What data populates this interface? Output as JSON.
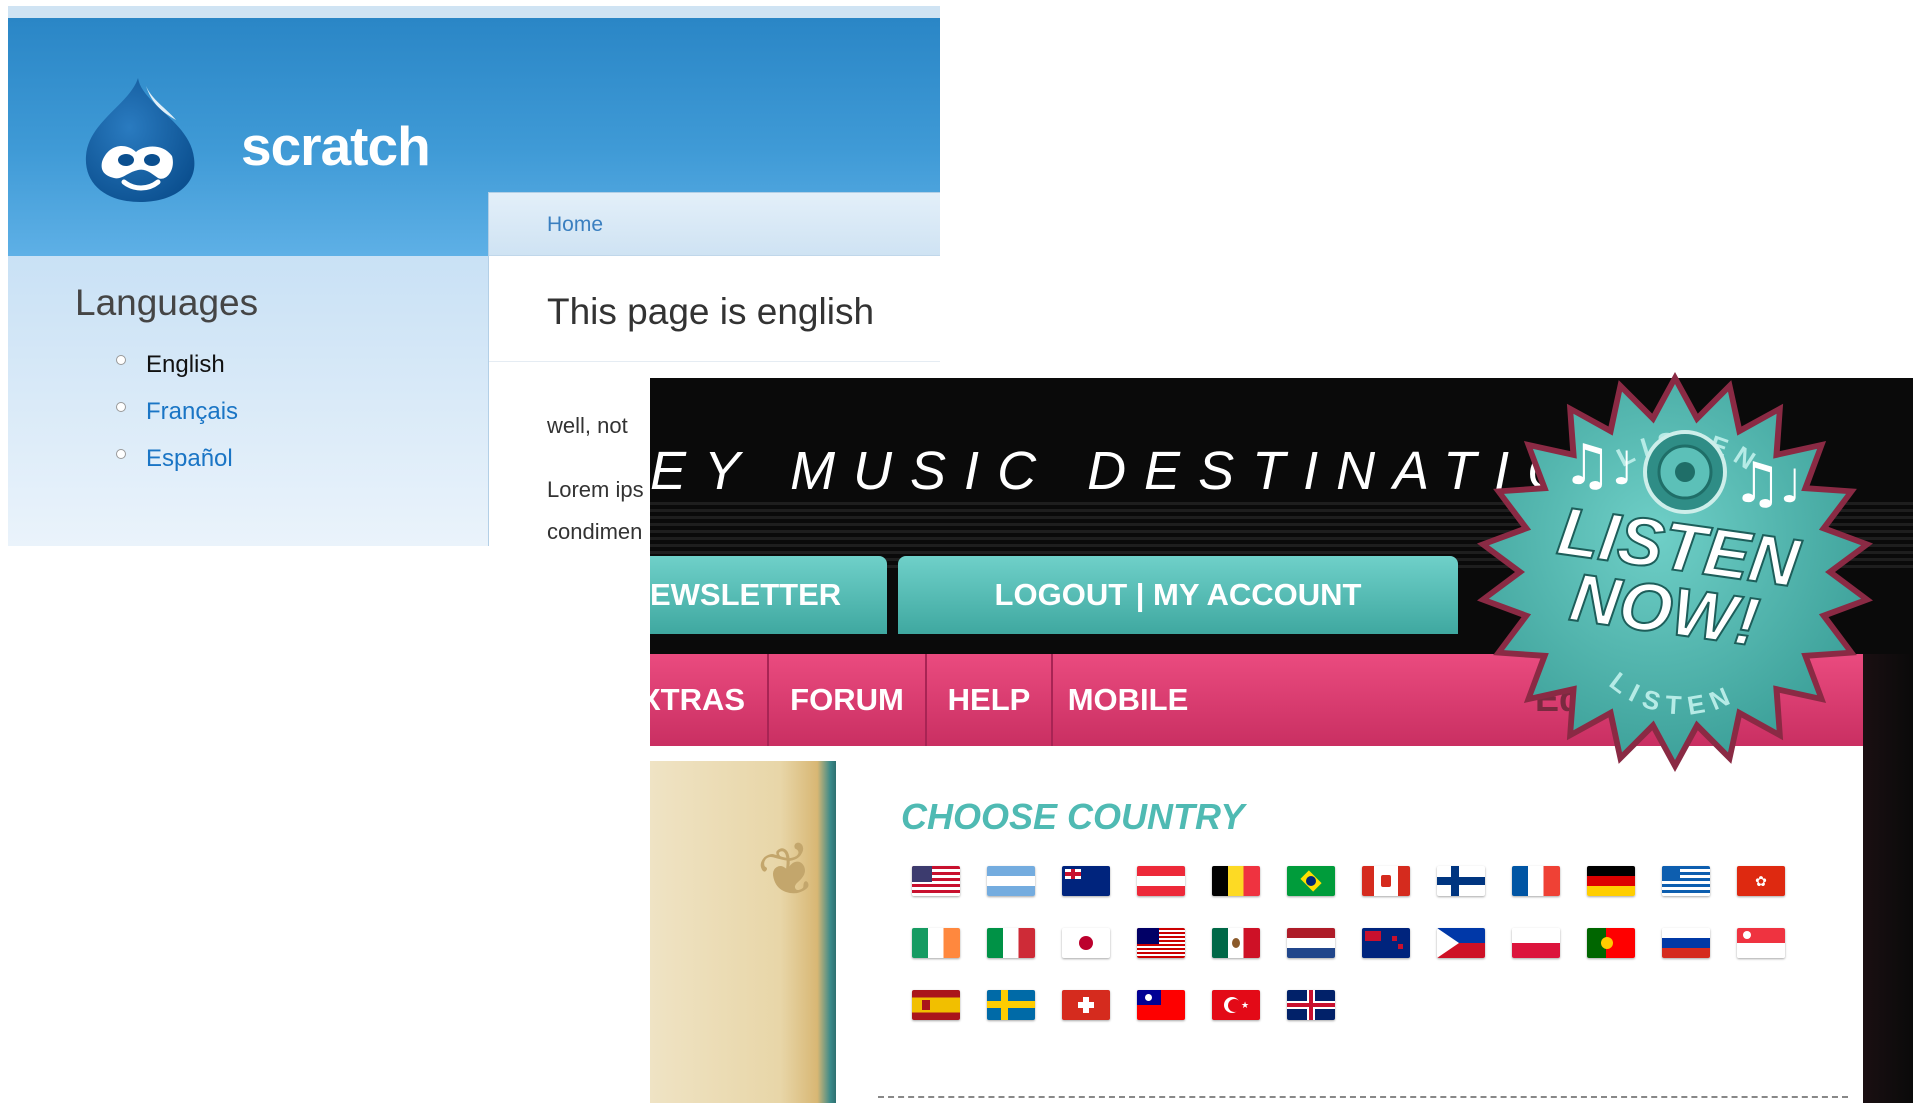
{
  "drupal": {
    "site_name": "scratch",
    "breadcrumb": "Home",
    "sidebar_title": "Languages",
    "languages": [
      {
        "label": "English",
        "active": true
      },
      {
        "label": "Français",
        "active": false
      },
      {
        "label": "Español",
        "active": false
      }
    ],
    "page_title": "This page is english",
    "body_paragraphs": [
      "well, not",
      "Lorem ips",
      "condimen"
    ]
  },
  "music": {
    "destination_title": "EY MUSIC DESTINATION",
    "top_tabs": [
      "EWSLETTER",
      "LOGOUT | MY ACCOUNT"
    ],
    "nav_items": [
      "XTRAS",
      "FORUM",
      "HELP",
      "MOBILE"
    ],
    "edit_label": "Edit",
    "choose_country_title": "CHOOSE COUNTRY",
    "badge": {
      "main_line1": "LISTEN",
      "main_line2": "NOW!",
      "arc_top": "LISTEN",
      "arc_bottom": "LISTEN"
    },
    "flags": [
      "usa",
      "argentina",
      "australia",
      "austria",
      "belgium",
      "brazil",
      "canada",
      "finland",
      "france",
      "germany",
      "greece",
      "hong-kong",
      "ireland",
      "italy",
      "japan",
      "malaysia",
      "mexico",
      "netherlands",
      "new-zealand",
      "philippines",
      "poland",
      "portugal",
      "russia",
      "singapore",
      "spain",
      "sweden",
      "switzerland",
      "taiwan",
      "turkey",
      "united-kingdom"
    ]
  },
  "colors": {
    "drupal_blue": "#2a86c6",
    "link_blue": "#1a75c5",
    "teal": "#4fbab3",
    "pink": "#e0447a"
  }
}
